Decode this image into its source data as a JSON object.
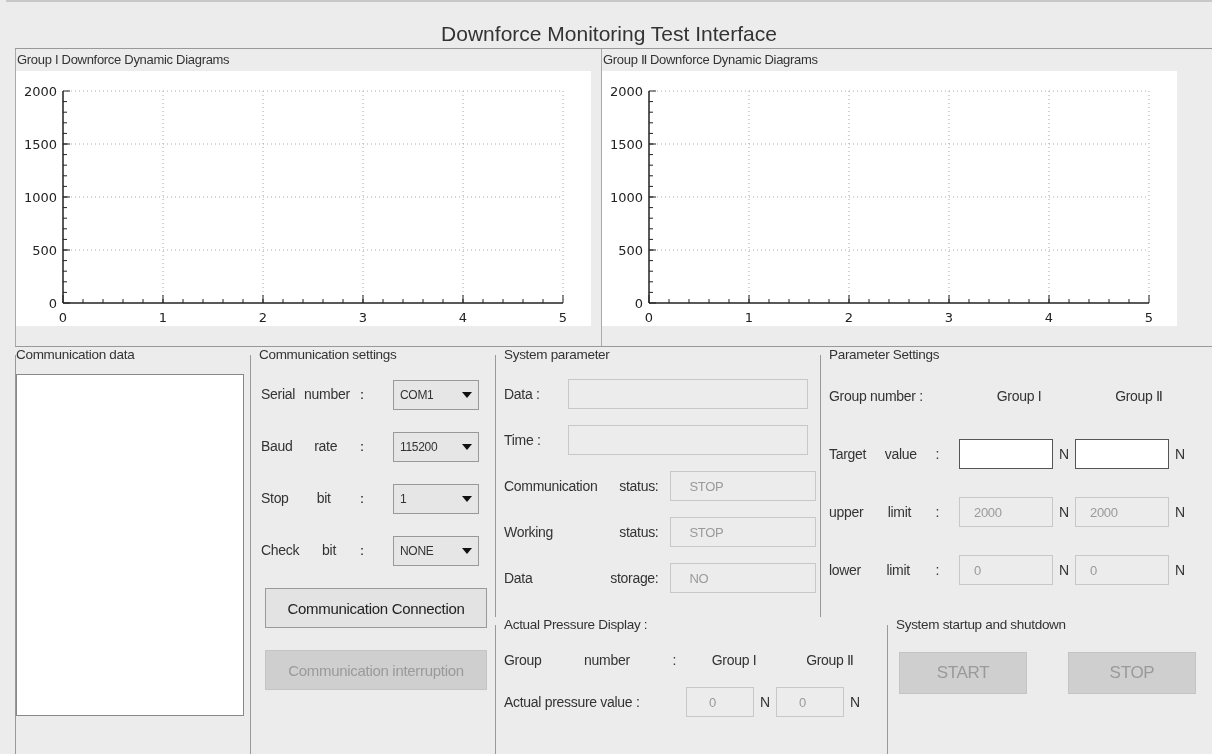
{
  "window": {
    "title": "Downforce Monitoring Test Interface"
  },
  "charts": [
    {
      "chart_data": {
        "type": "line",
        "title": "Group I Downforce Dynamic Diagrams",
        "grid": true,
        "xlim": [
          0,
          5
        ],
        "ylim": [
          0,
          2000
        ],
        "xticks": [
          0,
          1,
          2,
          3,
          4,
          5
        ],
        "yticks": [
          0,
          500,
          1000,
          1500,
          2000
        ]
      }
    },
    {
      "chart_data": {
        "type": "line",
        "title": "Group Ⅱ Downforce Dynamic Diagrams",
        "grid": true,
        "xlim": [
          0,
          5
        ],
        "ylim": [
          0,
          2000
        ],
        "xticks": [
          0,
          1,
          2,
          3,
          4,
          5
        ],
        "yticks": [
          0,
          500,
          1000,
          1500,
          2000
        ]
      }
    }
  ],
  "communication_data": {
    "title": "Communication data"
  },
  "communication_settings": {
    "title": "Communication settings",
    "fields": [
      {
        "label": "Serial number：",
        "value": "COM1"
      },
      {
        "label": "Baud rate：",
        "value": "115200"
      },
      {
        "label": "Stop bit：",
        "value": "1"
      },
      {
        "label": "Check bit：",
        "value": "NONE"
      }
    ],
    "buttons": [
      {
        "label": "Communication Connection",
        "disabled": false
      },
      {
        "label": "Communication interruption",
        "disabled": true
      }
    ]
  },
  "system_parameter": {
    "title": "System parameter",
    "fields": [
      {
        "label": "Data :",
        "kind": "wide",
        "disabled": true
      },
      {
        "label": "Time :",
        "kind": "wide",
        "disabled": true
      },
      {
        "label": "Communication status:",
        "kind": "short",
        "value": "STOP",
        "disabled": true
      },
      {
        "label": "Working status:",
        "kind": "short",
        "value": "STOP",
        "disabled": true
      },
      {
        "label": "Data storage:",
        "kind": "short",
        "value": "NO",
        "disabled": true
      }
    ]
  },
  "parameter_settings": {
    "title": "Parameter Settings",
    "header": [
      "Group number :",
      "Group I",
      "Group Ⅱ"
    ],
    "rows": [
      {
        "label": "Target value :",
        "cells": [
          {
            "unit": "N",
            "disabled": false
          },
          {
            "unit": "N",
            "disabled": false
          }
        ]
      },
      {
        "label": "upper limit :",
        "cells": [
          {
            "value": "2000",
            "unit": "N",
            "disabled": true
          },
          {
            "value": "2000",
            "unit": "N",
            "disabled": true
          }
        ]
      },
      {
        "label": "lower limit :",
        "cells": [
          {
            "value": "0",
            "unit": "N",
            "disabled": true
          },
          {
            "value": "0",
            "unit": "N",
            "disabled": true
          }
        ]
      }
    ]
  },
  "actual_pressure": {
    "title": "Actual Pressure Display :",
    "header": [
      "Group number :",
      "Group I",
      "Group Ⅱ"
    ],
    "row": {
      "label": "Actual pressure value :",
      "cells": [
        {
          "value": "0",
          "unit": "N",
          "disabled": true
        },
        {
          "value": "0",
          "unit": "N",
          "disabled": true
        }
      ]
    }
  },
  "system_startup": {
    "title": "System startup and shutdown",
    "buttons": [
      {
        "label": "START",
        "disabled": true
      },
      {
        "label": "STOP",
        "disabled": true
      }
    ]
  }
}
